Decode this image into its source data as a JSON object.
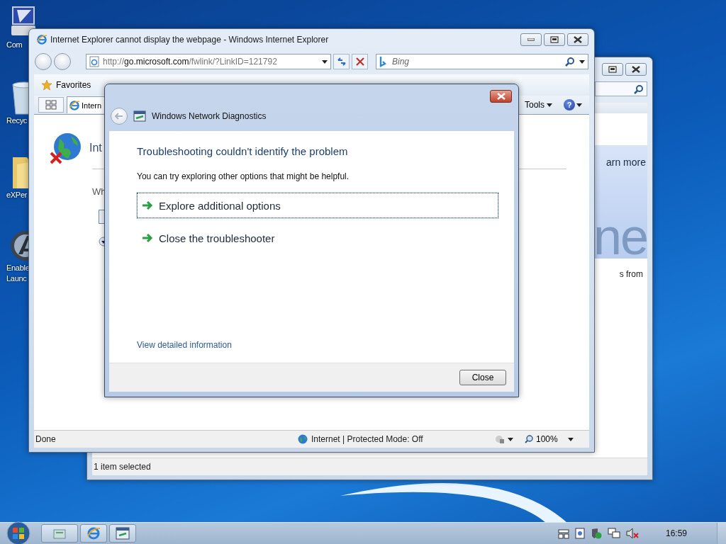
{
  "desktop_icons": [
    {
      "kind": "computer",
      "label_lines": [
        "Com"
      ]
    },
    {
      "kind": "recycle-bin",
      "label_lines": [
        "Recyc"
      ]
    },
    {
      "kind": "folder",
      "label_lines": [
        "eXPer"
      ]
    },
    {
      "kind": "app",
      "label_lines": [
        "Enable",
        "Launc"
      ]
    }
  ],
  "back_window": {
    "link_text": "arn more",
    "banner_text": "ne",
    "body_text": "s from",
    "status_text": "1 item selected"
  },
  "browser": {
    "title": "Internet Explorer cannot display the webpage - Windows Internet Explorer",
    "address_parts": [
      "http://",
      "go.microsoft.com",
      "/fwlink/?LinkID=121792"
    ],
    "search_placeholder": "Bing",
    "favorites_label": "Favorites",
    "tab_label": "Intern",
    "tools_label": "Tools",
    "help_glyph": "?",
    "page": {
      "heading": "Int",
      "text": "Wh"
    },
    "status": {
      "text": "Done",
      "zone": "Internet | Protected Mode: Off",
      "zoom": "100%"
    }
  },
  "dialog": {
    "title": "Windows Network Diagnostics",
    "heading": "Troubleshooting couldn't identify the problem",
    "message": "You can try exploring other options that might be helpful.",
    "options": [
      {
        "label": "Explore additional options",
        "selected": true
      },
      {
        "label": "Close the troubleshooter",
        "selected": false
      }
    ],
    "link": "View detailed information",
    "button": "Close"
  },
  "taskbar": {
    "buttons": [
      {
        "kind": "explorer"
      },
      {
        "kind": "browser"
      },
      {
        "kind": "diagnostics"
      }
    ],
    "clock": "16:59"
  }
}
